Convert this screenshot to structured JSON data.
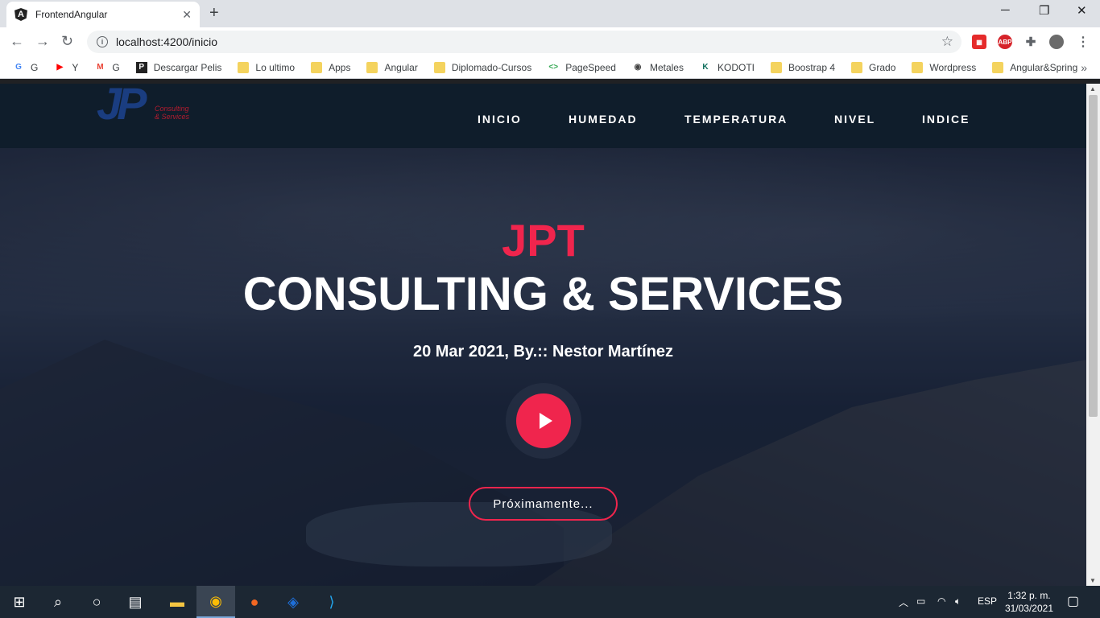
{
  "browser": {
    "tab_title": "FrontendAngular",
    "tab_close": "✕",
    "new_tab": "+",
    "url": "localhost:4200/inicio",
    "bookmarks": [
      {
        "label": "G",
        "icon": "google-icon",
        "icon_char": "G",
        "color": "#4285f4"
      },
      {
        "label": "Y",
        "icon": "youtube-icon",
        "icon_char": "▶",
        "color": "#ff0000"
      },
      {
        "label": "G",
        "icon": "gmail-icon",
        "icon_char": "M",
        "color": "#ea4335"
      },
      {
        "label": "Descargar Pelis",
        "icon": "p-icon",
        "icon_char": "P",
        "color": "#222222"
      },
      {
        "label": "Lo ultimo",
        "icon": "folder-icon",
        "icon_char": "",
        "color": "#f4d35e"
      },
      {
        "label": "Apps",
        "icon": "folder-icon",
        "icon_char": "",
        "color": "#f4d35e"
      },
      {
        "label": "Angular",
        "icon": "folder-icon",
        "icon_char": "",
        "color": "#f4d35e"
      },
      {
        "label": "Diplomado-Cursos",
        "icon": "folder-icon",
        "icon_char": "",
        "color": "#f4d35e"
      },
      {
        "label": "PageSpeed",
        "icon": "pagespeed-icon",
        "icon_char": "<>",
        "color": "#34a853"
      },
      {
        "label": "Metales",
        "icon": "globe-icon",
        "icon_char": "◉",
        "color": "#444444"
      },
      {
        "label": "KODOTI",
        "icon": "kodoti-icon",
        "icon_char": "K",
        "color": "#0e6e5c"
      },
      {
        "label": "Boostrap 4",
        "icon": "folder-icon",
        "icon_char": "",
        "color": "#f4d35e"
      },
      {
        "label": "Grado",
        "icon": "folder-icon",
        "icon_char": "",
        "color": "#f4d35e"
      },
      {
        "label": "Wordpress",
        "icon": "folder-icon",
        "icon_char": "",
        "color": "#f4d35e"
      },
      {
        "label": "Angular&Spring",
        "icon": "folder-icon",
        "icon_char": "",
        "color": "#f4d35e"
      }
    ],
    "more": "»"
  },
  "site": {
    "logo_text": "JP",
    "logo_sub_1": "Consulting",
    "logo_sub_2": "& Services",
    "menu": [
      "INICIO",
      "HUMEDAD",
      "TEMPERATURA",
      "NIVEL",
      "INDICE"
    ],
    "hero_brand": "JPT",
    "hero_title": "CONSULTING & SERVICES",
    "hero_date": "20 Mar 2021, By.:: Nestor Martínez",
    "cta": "Próximamente...",
    "accent_color": "#f0254d"
  },
  "taskbar": {
    "lang": "ESP",
    "time": "1:32 p. m.",
    "date": "31/03/2021"
  }
}
